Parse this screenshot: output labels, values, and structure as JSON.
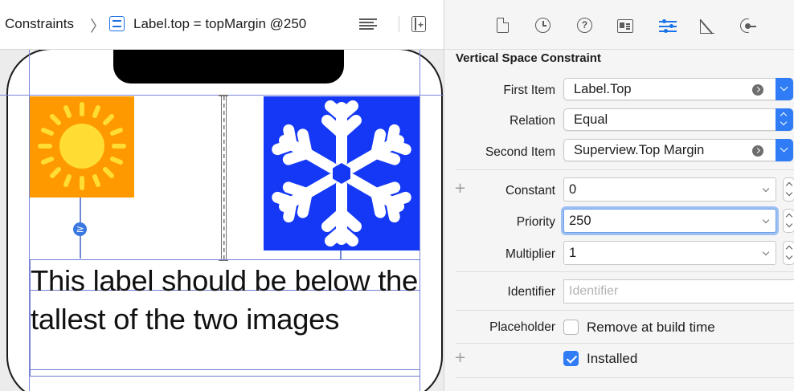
{
  "jumpbar": {
    "crumb_parent": "Constraints",
    "crumb_separator": "〉",
    "crumb_current": "Label.top = topMargin @250",
    "icons": [
      "constraint-icon",
      "list-lines-icon",
      "add-editor-icon"
    ]
  },
  "canvas": {
    "label_text": "This label should be below the tallest of the two images",
    "ge_symbol": "≥",
    "sun_color": "#ff9900",
    "snow_color": "#1438f5",
    "guide_color": "#7b86d9"
  },
  "inspector": {
    "toolbar_icons": [
      "file-icon",
      "history-icon",
      "help-icon",
      "identity-icon",
      "attributes-icon",
      "size-ruler-icon",
      "connections-icon"
    ],
    "section_title": "Vertical Space Constraint",
    "first_item": {
      "label": "First Item",
      "value": "Label.Top"
    },
    "relation": {
      "label": "Relation",
      "value": "Equal"
    },
    "second_item": {
      "label": "Second Item",
      "value": "Superview.Top Margin"
    },
    "constant": {
      "label": "Constant",
      "value": "0"
    },
    "priority": {
      "label": "Priority",
      "value": "250"
    },
    "multiplier": {
      "label": "Multiplier",
      "value": "1"
    },
    "identifier": {
      "label": "Identifier",
      "placeholder": "Identifier"
    },
    "placeholder": {
      "label": "Placeholder",
      "option": "Remove at build time",
      "checked": false
    },
    "installed": {
      "option": "Installed",
      "checked": true
    },
    "plus_symbol": "+",
    "accent_color": "#2f7cf6"
  }
}
